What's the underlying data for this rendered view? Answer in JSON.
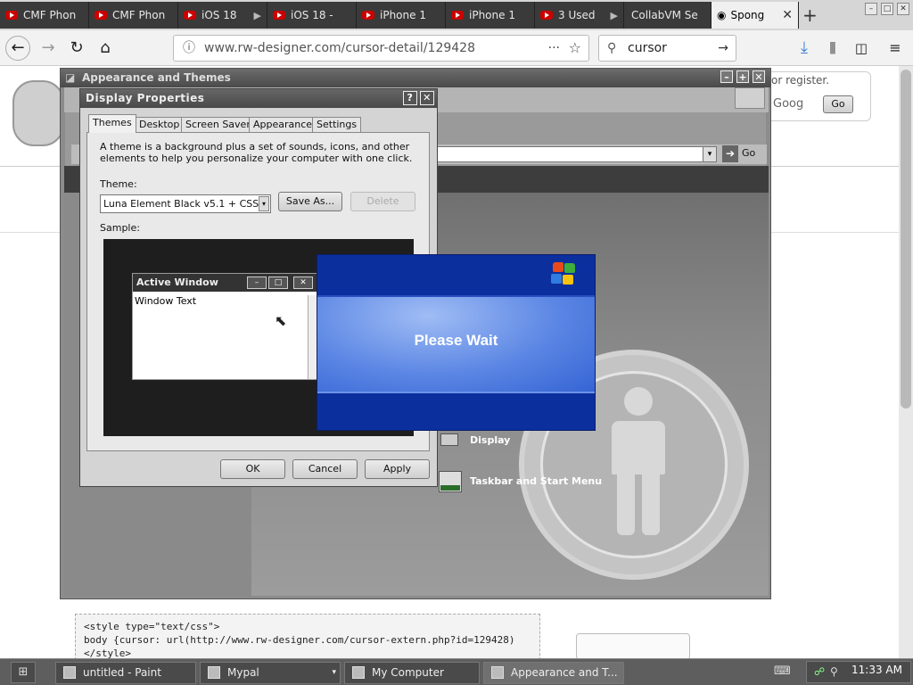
{
  "browser": {
    "tabs": [
      {
        "label": "CMF Phon",
        "icon": "youtube-icon"
      },
      {
        "label": "CMF Phon",
        "icon": "youtube-icon"
      },
      {
        "label": "iOS 18",
        "icon": "youtube-icon"
      },
      {
        "label": "iOS 18 -",
        "icon": "youtube-icon"
      },
      {
        "label": "iPhone 1",
        "icon": "youtube-icon"
      },
      {
        "label": "iPhone 1",
        "icon": "youtube-icon"
      },
      {
        "label": "3 Used",
        "icon": "youtube-icon"
      },
      {
        "label": "CollabVM Se",
        "icon": ""
      },
      {
        "label": "Spong",
        "icon": "globe-icon",
        "active": true
      }
    ],
    "url": "www.rw-designer.com/cursor-detail/129428",
    "search_value": "cursor"
  },
  "page": {
    "register_text": "or register.",
    "google_label": "Goog",
    "go_label": "Go",
    "addr_go_label": "Go",
    "code_lines": [
      "<style type=\"text/css\">",
      "body {cursor: url(http://www.rw-designer.com/cursor-extern.php?id=129428)",
      "</style>"
    ]
  },
  "appearance_window": {
    "title": "Appearance and Themes",
    "tasks": [
      "Display",
      "Taskbar and Start Menu"
    ]
  },
  "display_properties": {
    "title": "Display Properties",
    "tabs": [
      "Themes",
      "Desktop",
      "Screen Saver",
      "Appearance",
      "Settings"
    ],
    "description": "A theme is a background plus a set of sounds, icons, and other elements to help you personalize your computer with one click.",
    "theme_label": "Theme:",
    "theme_value": "Luna Element Black v5.1 + CSS",
    "save_as_label": "Save As...",
    "delete_label": "Delete",
    "sample_label": "Sample:",
    "sample_window": {
      "title": "Active Window",
      "body_text": "Window Text"
    },
    "ok_label": "OK",
    "cancel_label": "Cancel",
    "apply_label": "Apply"
  },
  "please_wait": {
    "text": "Please Wait"
  },
  "taskbar": {
    "items": [
      {
        "label": "untitled - Paint"
      },
      {
        "label": "Mypal"
      },
      {
        "label": "My Computer"
      },
      {
        "label": "Appearance and T..."
      }
    ],
    "clock": "11:33 AM"
  }
}
